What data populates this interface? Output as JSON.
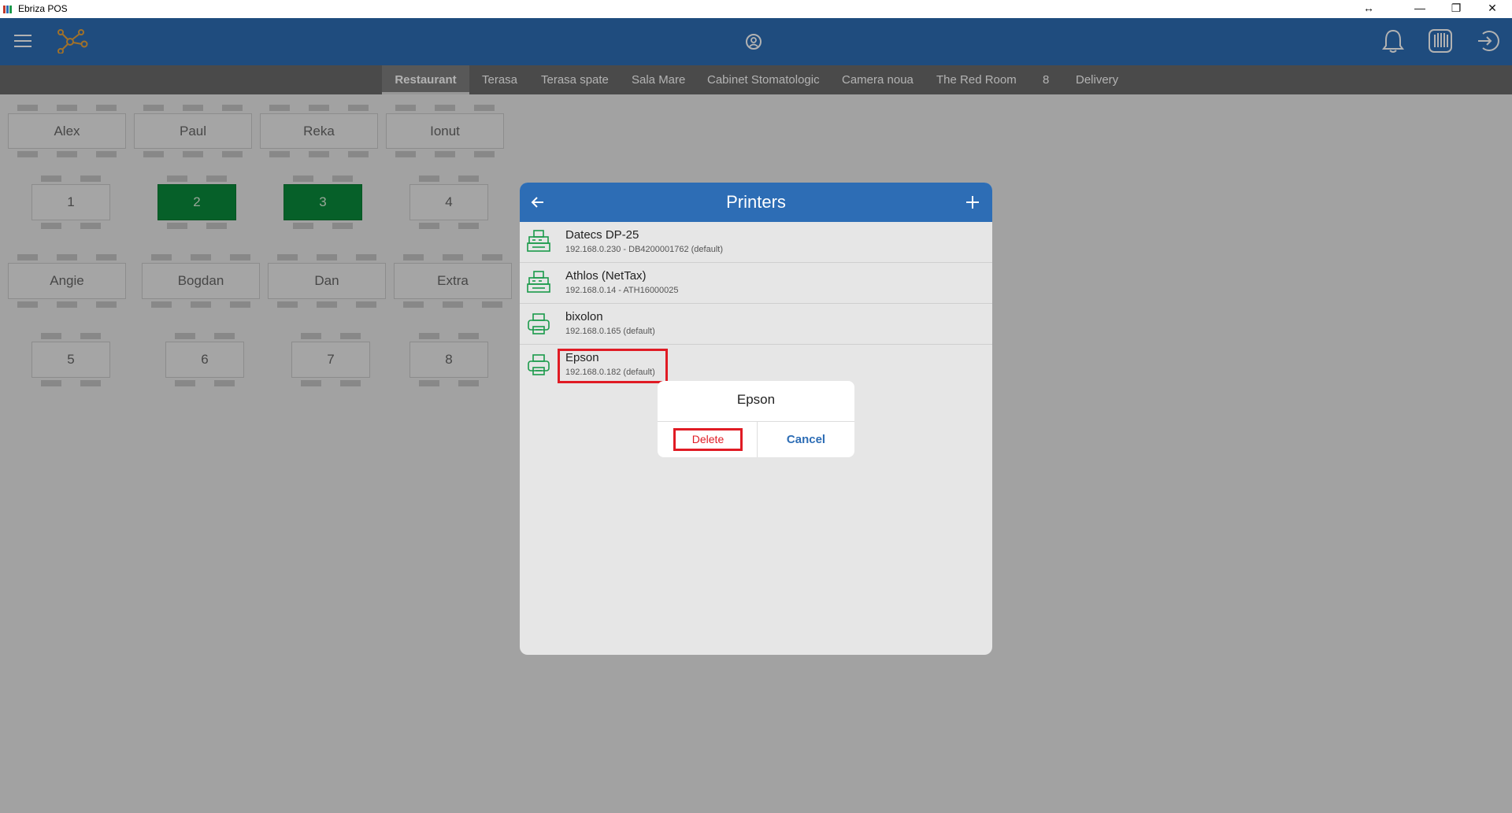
{
  "window": {
    "title": "Ebriza POS",
    "resize_glyph": "↔",
    "minimize_glyph": "—",
    "restore_glyph": "❐",
    "close_glyph": "✕"
  },
  "header": {
    "icons": [
      "menu-icon",
      "network-icon",
      "support-icon",
      "bell-icon",
      "cash-register-icon",
      "logout-icon"
    ],
    "accent": "#2d6db5"
  },
  "tabs": [
    "Restaurant",
    "Terasa",
    "Terasa spate",
    "Sala Mare",
    "Cabinet Stomatologic",
    "Camera noua",
    "The Red Room",
    "8",
    "Delivery"
  ],
  "active_tab": "Restaurant",
  "floor": {
    "tables_row1": [
      "Alex",
      "Paul",
      "Reka",
      "Ionut"
    ],
    "tables_row2": [
      "1",
      "2",
      "3",
      "4"
    ],
    "tables_row3": [
      "Angie",
      "Bogdan",
      "Dan",
      "Extra"
    ],
    "tables_row4": [
      "5",
      "6",
      "7",
      "8"
    ],
    "busy_tables": [
      "2",
      "3"
    ],
    "busy_color": "#0a8a3b"
  },
  "printers_modal": {
    "title": "Printers",
    "back_icon": "arrow-left-icon",
    "add_icon": "plus-icon",
    "printers": [
      {
        "name": "Datecs DP-25",
        "detail": "192.168.0.230 - DB4200001762 (default)",
        "icon": "fiscal-printer-icon"
      },
      {
        "name": "Athlos (NetTax)",
        "detail": "192.168.0.14 - ATH16000025",
        "icon": "fiscal-printer-icon"
      },
      {
        "name": "bixolon",
        "detail": "192.168.0.165 (default)",
        "icon": "printer-icon"
      },
      {
        "name": "Epson",
        "detail": "192.168.0.182 (default)",
        "icon": "printer-icon"
      }
    ]
  },
  "confirm_dialog": {
    "title": "Epson",
    "delete_label": "Delete",
    "cancel_label": "Cancel"
  },
  "colors": {
    "highlight": "#e01b24",
    "printer_icon": "#1a9a4a"
  }
}
